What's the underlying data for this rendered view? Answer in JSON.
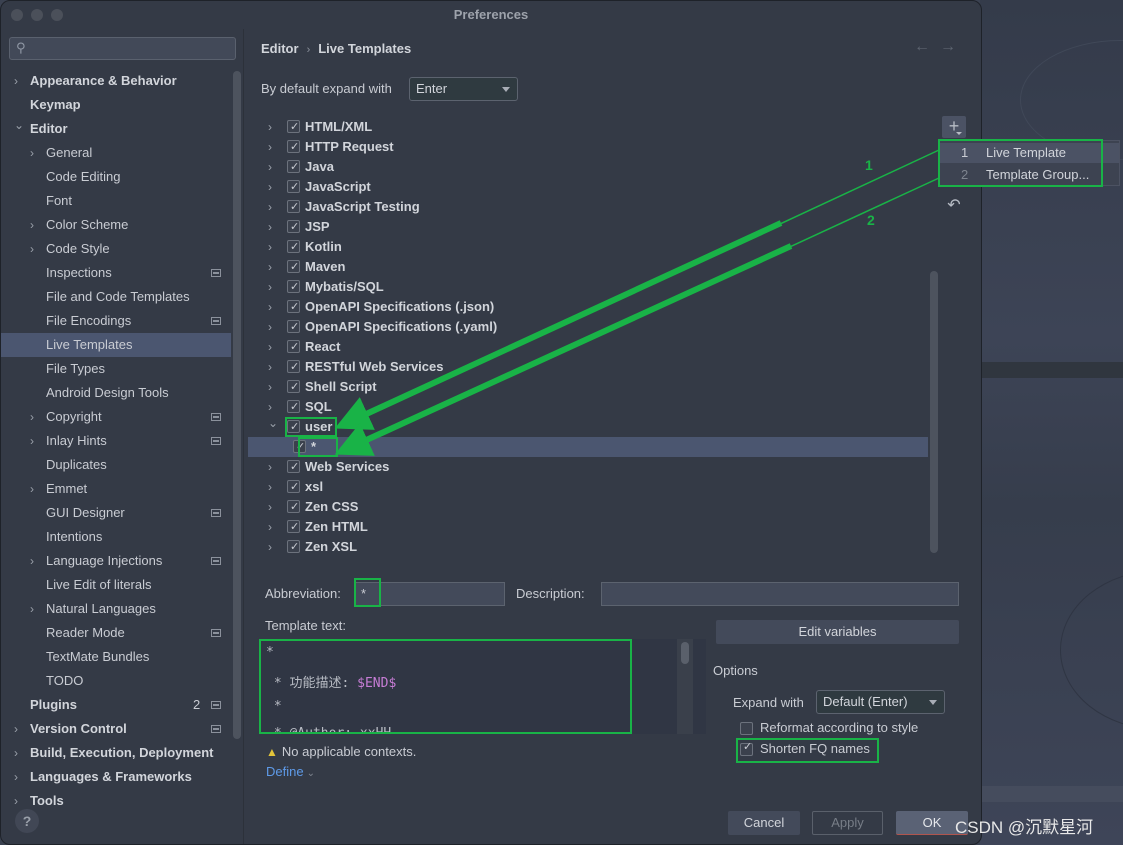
{
  "window": {
    "title": "Preferences"
  },
  "sidebar": {
    "search_placeholder": "",
    "items": [
      {
        "label": "Appearance & Behavior",
        "level": 0,
        "bold": true,
        "chevron": "right",
        "badge": false
      },
      {
        "label": "Keymap",
        "level": 0,
        "bold": true,
        "chevron": "",
        "badge": false
      },
      {
        "label": "Editor",
        "level": 0,
        "bold": true,
        "chevron": "down",
        "badge": false
      },
      {
        "label": "General",
        "level": 1,
        "bold": false,
        "chevron": "right",
        "badge": false
      },
      {
        "label": "Code Editing",
        "level": 1,
        "bold": false,
        "chevron": "",
        "badge": false
      },
      {
        "label": "Font",
        "level": 1,
        "bold": false,
        "chevron": "",
        "badge": false
      },
      {
        "label": "Color Scheme",
        "level": 1,
        "bold": false,
        "chevron": "right",
        "badge": false
      },
      {
        "label": "Code Style",
        "level": 1,
        "bold": false,
        "chevron": "right",
        "badge": false
      },
      {
        "label": "Inspections",
        "level": 1,
        "bold": false,
        "chevron": "",
        "badge": true
      },
      {
        "label": "File and Code Templates",
        "level": 1,
        "bold": false,
        "chevron": "",
        "badge": false
      },
      {
        "label": "File Encodings",
        "level": 1,
        "bold": false,
        "chevron": "",
        "badge": true
      },
      {
        "label": "Live Templates",
        "level": 1,
        "bold": false,
        "chevron": "",
        "badge": false,
        "selected": true
      },
      {
        "label": "File Types",
        "level": 1,
        "bold": false,
        "chevron": "",
        "badge": false
      },
      {
        "label": "Android Design Tools",
        "level": 1,
        "bold": false,
        "chevron": "",
        "badge": false
      },
      {
        "label": "Copyright",
        "level": 1,
        "bold": false,
        "chevron": "right",
        "badge": true
      },
      {
        "label": "Inlay Hints",
        "level": 1,
        "bold": false,
        "chevron": "right",
        "badge": true
      },
      {
        "label": "Duplicates",
        "level": 1,
        "bold": false,
        "chevron": "",
        "badge": false
      },
      {
        "label": "Emmet",
        "level": 1,
        "bold": false,
        "chevron": "right",
        "badge": false
      },
      {
        "label": "GUI Designer",
        "level": 1,
        "bold": false,
        "chevron": "",
        "badge": true
      },
      {
        "label": "Intentions",
        "level": 1,
        "bold": false,
        "chevron": "",
        "badge": false
      },
      {
        "label": "Language Injections",
        "level": 1,
        "bold": false,
        "chevron": "right",
        "badge": true
      },
      {
        "label": "Live Edit of literals",
        "level": 1,
        "bold": false,
        "chevron": "",
        "badge": false
      },
      {
        "label": "Natural Languages",
        "level": 1,
        "bold": false,
        "chevron": "right",
        "badge": false
      },
      {
        "label": "Reader Mode",
        "level": 1,
        "bold": false,
        "chevron": "",
        "badge": true
      },
      {
        "label": "TextMate Bundles",
        "level": 1,
        "bold": false,
        "chevron": "",
        "badge": false
      },
      {
        "label": "TODO",
        "level": 1,
        "bold": false,
        "chevron": "",
        "badge": false
      },
      {
        "label": "Plugins",
        "level": 0,
        "bold": true,
        "chevron": "",
        "badge": true,
        "count": "2"
      },
      {
        "label": "Version Control",
        "level": 0,
        "bold": true,
        "chevron": "right",
        "badge": true
      },
      {
        "label": "Build, Execution, Deployment",
        "level": 0,
        "bold": true,
        "chevron": "right",
        "badge": false
      },
      {
        "label": "Languages & Frameworks",
        "level": 0,
        "bold": true,
        "chevron": "right",
        "badge": false
      },
      {
        "label": "Tools",
        "level": 0,
        "bold": true,
        "chevron": "right",
        "badge": false
      }
    ],
    "help_label": "?"
  },
  "header": {
    "breadcrumb": [
      "Editor",
      "Live Templates"
    ],
    "breadcrumb_sep": "›",
    "back_icon": "←",
    "forward_icon": "→"
  },
  "expand": {
    "label": "By default expand with",
    "value": "Enter"
  },
  "template_groups": [
    {
      "name": "HTML/XML",
      "checked": true,
      "expanded": false
    },
    {
      "name": "HTTP Request",
      "checked": true,
      "expanded": false
    },
    {
      "name": "Java",
      "checked": true,
      "expanded": false
    },
    {
      "name": "JavaScript",
      "checked": true,
      "expanded": false
    },
    {
      "name": "JavaScript Testing",
      "checked": true,
      "expanded": false
    },
    {
      "name": "JSP",
      "checked": true,
      "expanded": false
    },
    {
      "name": "Kotlin",
      "checked": true,
      "expanded": false
    },
    {
      "name": "Maven",
      "checked": true,
      "expanded": false
    },
    {
      "name": "Mybatis/SQL",
      "checked": true,
      "expanded": false
    },
    {
      "name": "OpenAPI Specifications (.json)",
      "checked": true,
      "expanded": false
    },
    {
      "name": "OpenAPI Specifications (.yaml)",
      "checked": true,
      "expanded": false
    },
    {
      "name": "React",
      "checked": true,
      "expanded": false
    },
    {
      "name": "RESTful Web Services",
      "checked": true,
      "expanded": false
    },
    {
      "name": "Shell Script",
      "checked": true,
      "expanded": false
    },
    {
      "name": "SQL",
      "checked": true,
      "expanded": false
    },
    {
      "name": "user",
      "checked": true,
      "expanded": true,
      "children": [
        {
          "name": "*",
          "checked": true,
          "selected": true
        }
      ]
    },
    {
      "name": "Web Services",
      "checked": true,
      "expanded": false
    },
    {
      "name": "xsl",
      "checked": true,
      "expanded": false
    },
    {
      "name": "Zen CSS",
      "checked": true,
      "expanded": false
    },
    {
      "name": "Zen HTML",
      "checked": true,
      "expanded": false
    },
    {
      "name": "Zen XSL",
      "checked": true,
      "expanded": false
    }
  ],
  "toolbar": {
    "add_icon": "+",
    "restore_icon": "↶"
  },
  "add_popup": {
    "items": [
      {
        "num": "1",
        "label": "Live Template"
      },
      {
        "num": "2",
        "label": "Template Group..."
      }
    ]
  },
  "annotations": {
    "arrow_labels": [
      "1",
      "2"
    ],
    "color": "#19b347"
  },
  "details": {
    "abbreviation_label": "Abbreviation:",
    "abbreviation_value": "*",
    "description_label": "Description:",
    "description_value": "",
    "template_text_label": "Template text:",
    "template_lines": [
      {
        "text": "*",
        "var": ""
      },
      {
        "text": " * 功能描述: ",
        "var": "$END$"
      },
      {
        "text": " *",
        "var": ""
      },
      {
        "text": " * @Author: xxHH",
        "var": ""
      }
    ],
    "warning": "No applicable contexts.",
    "define_label": "Define",
    "edit_variables_label": "Edit variables",
    "options_label": "Options",
    "expand_with_label": "Expand with",
    "expand_with_value": "Default (Enter)",
    "reformat_label": "Reformat according to style",
    "reformat_checked": false,
    "shorten_label": "Shorten FQ names",
    "shorten_checked": true
  },
  "footer": {
    "cancel_label": "Cancel",
    "apply_label": "Apply",
    "ok_label": "OK"
  },
  "watermark": "CSDN @沉默星河"
}
